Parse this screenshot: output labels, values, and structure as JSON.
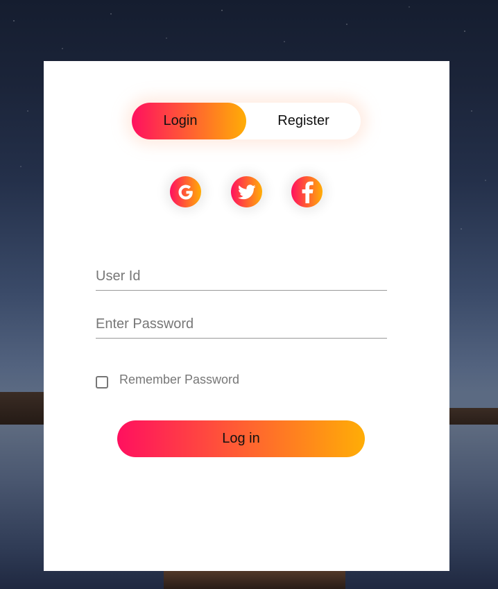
{
  "tabs": {
    "login_label": "Login",
    "register_label": "Register",
    "active": "login"
  },
  "social": [
    {
      "name": "google",
      "icon": "google-icon"
    },
    {
      "name": "twitter",
      "icon": "twitter-icon"
    },
    {
      "name": "facebook",
      "icon": "facebook-icon"
    }
  ],
  "form": {
    "user_id_placeholder": "User Id",
    "user_id_value": "",
    "password_placeholder": "Enter Password",
    "password_value": "",
    "remember_label": "Remember Password",
    "remember_checked": false,
    "submit_label": "Log in"
  },
  "colors": {
    "gradient_start": "#ff105f",
    "gradient_end": "#ffad06",
    "card_background": "#ffffff"
  }
}
